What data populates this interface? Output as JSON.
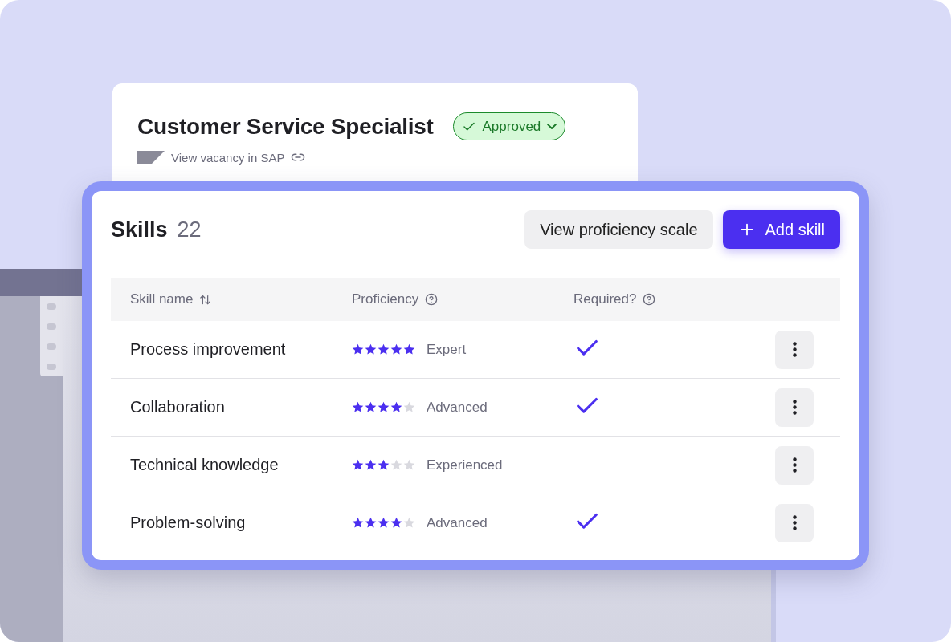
{
  "vacancy": {
    "title": "Customer Service Specialist",
    "status": {
      "label": "Approved",
      "kind": "approved"
    },
    "link": "View vacancy in SAP"
  },
  "skills": {
    "title": "Skills",
    "count": "22",
    "buttons": [
      {
        "label": "View proficiency scale",
        "kind": "secondary"
      },
      {
        "label": "Add skill",
        "kind": "primary"
      }
    ],
    "columns": [
      {
        "label": "Skill name"
      },
      {
        "label": "Proficiency"
      },
      {
        "label": "Required?"
      }
    ],
    "rows": [
      {
        "name": "Process improvement",
        "stars": 5,
        "level_label": "Expert",
        "required": true
      },
      {
        "name": "Collaboration",
        "stars": 4,
        "level_label": "Advanced",
        "required": true
      },
      {
        "name": "Technical knowledge",
        "stars": 3,
        "level_label": "Experienced",
        "required": false
      },
      {
        "name": "Problem-solving",
        "stars": 4,
        "level_label": "Advanced",
        "required": true
      }
    ]
  }
}
